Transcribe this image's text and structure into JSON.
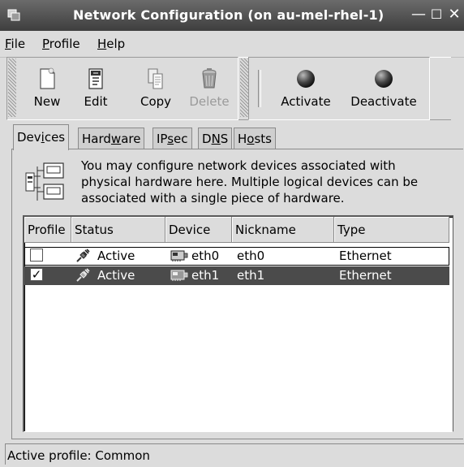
{
  "window": {
    "title": "Network Configuration (on au-mel-rhel-1)"
  },
  "menu": [
    {
      "label": "File",
      "mnemonic": "F",
      "rest": "ile"
    },
    {
      "label": "Profile",
      "mnemonic": "P",
      "rest": "rofile"
    },
    {
      "label": "Help",
      "mnemonic": "H",
      "rest": "elp"
    }
  ],
  "toolbar": {
    "new_label": "New",
    "edit_label": "Edit",
    "copy_label": "Copy",
    "delete_label": "Delete",
    "activate_label": "Activate",
    "deactivate_label": "Deactivate"
  },
  "tabs": [
    {
      "pre": "Dev",
      "u": "i",
      "post": "ces",
      "active": true
    },
    {
      "pre": "Hard",
      "u": "w",
      "post": "are",
      "active": false
    },
    {
      "pre": "IP",
      "u": "s",
      "post": "ec",
      "active": false
    },
    {
      "pre": "D",
      "u": "N",
      "post": "S",
      "active": false
    },
    {
      "pre": "H",
      "u": "o",
      "post": "sts",
      "active": false
    }
  ],
  "info": {
    "line1": "You may configure network devices associated with",
    "line2": "physical hardware here.  Multiple logical devices can be",
    "line3": "associated with a single piece of hardware."
  },
  "table": {
    "columns": [
      "Profile",
      "Status",
      "Device",
      "Nickname",
      "Type"
    ],
    "rows": [
      {
        "profile_checked": false,
        "status": "Active",
        "device": "eth0",
        "nickname": "eth0",
        "type": "Ethernet",
        "selected": false
      },
      {
        "profile_checked": true,
        "status": "Active",
        "device": "eth1",
        "nickname": "eth1",
        "type": "Ethernet",
        "selected": true
      }
    ]
  },
  "statusbar": {
    "text": "Active profile: Common"
  },
  "colors": {
    "selection": "#4b4b4b",
    "titlebar": "#4a4a4a"
  }
}
